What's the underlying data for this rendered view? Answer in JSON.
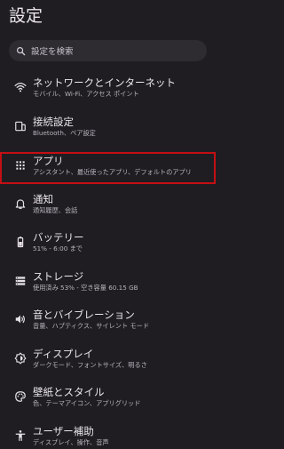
{
  "header": {
    "title": "設定"
  },
  "search": {
    "placeholder": "設定を検索",
    "icon": "search-icon"
  },
  "items": [
    {
      "id": "network",
      "title": "ネットワークとインターネット",
      "subtitle": "モバイル、Wi-Fi、アクセス ポイント",
      "icon": "wifi-icon"
    },
    {
      "id": "connected-devices",
      "title": "接続設定",
      "subtitle": "Bluetooth、ペア設定",
      "icon": "connected-devices-icon"
    },
    {
      "id": "apps",
      "title": "アプリ",
      "subtitle": "アシスタント、最近使ったアプリ、デフォルトのアプリ",
      "icon": "apps-grid-icon"
    },
    {
      "id": "notifications",
      "title": "通知",
      "subtitle": "通知履歴、会話",
      "icon": "bell-icon"
    },
    {
      "id": "battery",
      "title": "バッテリー",
      "subtitle": "51% - 6:00 まで",
      "icon": "battery-icon"
    },
    {
      "id": "storage",
      "title": "ストレージ",
      "subtitle": "使用済み 53% - 空き容量 60.15 GB",
      "icon": "storage-icon"
    },
    {
      "id": "sound",
      "title": "音とバイブレーション",
      "subtitle": "音量、ハプティクス、サイレント モード",
      "icon": "volume-icon"
    },
    {
      "id": "display",
      "title": "ディスプレイ",
      "subtitle": "ダークモード、フォントサイズ、明るさ",
      "icon": "brightness-icon"
    },
    {
      "id": "wallpaper",
      "title": "壁紙とスタイル",
      "subtitle": "色、テーマアイコン、アプリグリッド",
      "icon": "palette-icon"
    },
    {
      "id": "accessibility",
      "title": "ユーザー補助",
      "subtitle": "ディスプレイ、操作、音声",
      "icon": "accessibility-icon"
    }
  ],
  "colors": {
    "background": "#1f1d22",
    "search_background": "#2e2b31",
    "highlight_border": "#c40f14",
    "text_primary": "#ece6ec",
    "text_secondary": "#b9b3bb"
  }
}
